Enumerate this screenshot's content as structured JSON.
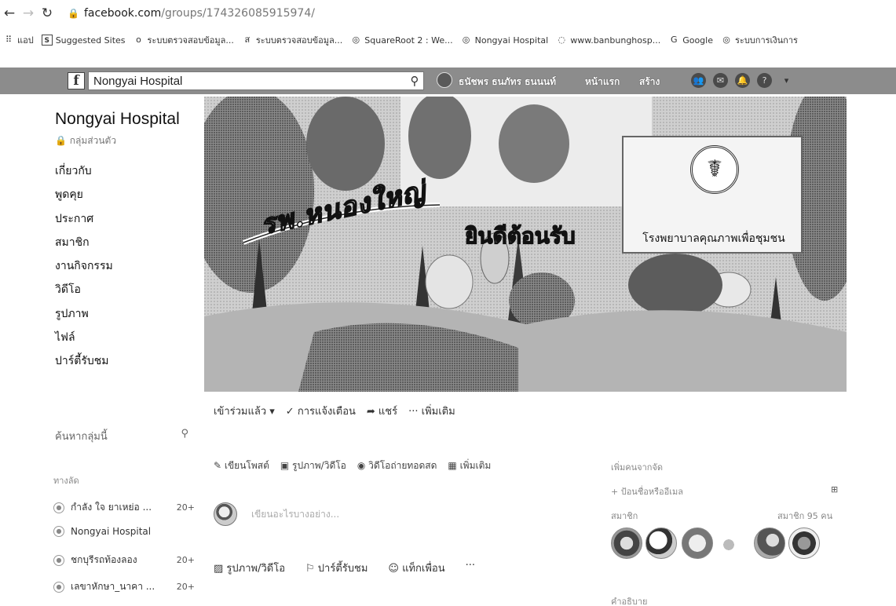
{
  "browser": {
    "url_host": "facebook.com",
    "url_path": "/groups/174326085915974/",
    "bookmarks": [
      {
        "icon": "apps-icon",
        "glyph": "⠿",
        "label": "แอป"
      },
      {
        "icon": "bookmark-icon",
        "glyph": "S",
        "label": "Suggested Sites"
      },
      {
        "icon": "site-icon",
        "glyph": "o",
        "label": "ระบบตรวจสอบข้อมูล..."
      },
      {
        "icon": "site-icon",
        "glyph": "ส",
        "label": "ระบบตรวจสอบข้อมูล..."
      },
      {
        "icon": "globe-icon",
        "glyph": "◎",
        "label": "SquareRoot 2 : We..."
      },
      {
        "icon": "globe-icon",
        "glyph": "◎",
        "label": "Nongyai Hospital"
      },
      {
        "icon": "site-icon",
        "glyph": "◌",
        "label": "www.banbunghosp..."
      },
      {
        "icon": "google-icon",
        "glyph": "G",
        "label": "Google"
      },
      {
        "icon": "globe-icon",
        "glyph": "◎",
        "label": "ระบบการเงินการ"
      }
    ]
  },
  "topbar": {
    "search_value": "Nongyai  Hospital",
    "user_name": "ธนัชพร ธนภัทร ธนนนท์",
    "home": "หน้าแรก",
    "create": "สร้าง"
  },
  "group": {
    "name": "Nongyai Hospital",
    "type": "กลุ่มส่วนตัว",
    "menu": [
      "เกี่ยวกับ",
      "พูดคุย",
      "ประกาศ",
      "สมาชิก",
      "งานกิจกรรม",
      "วิดีโอ",
      "รูปภาพ",
      "ไฟล์",
      "ปาร์ตี้รับชม"
    ],
    "search_placeholder": "ค้นหากลุ่มนี้",
    "shortcuts_title": "ทางลัด",
    "shortcuts": [
      {
        "label": "กำลัง ใจ ยาเหย่อ ...",
        "count": "20+"
      },
      {
        "label": "Nongyai Hospital",
        "count": ""
      },
      {
        "label": "ชกบุรีรถท้องลอง",
        "count": "20+"
      },
      {
        "label": "เลขาหักษา_นาคา ...",
        "count": "20+"
      }
    ]
  },
  "cover": {
    "banner_text": "รพ.หนองใหญ่",
    "welcome_text": "ยินดีต้อนรับ",
    "sign_text": "โรงพยาบาลคุณภาพเพื่อชุมชน"
  },
  "actions": [
    "เข้าร่วมแล้ว ▾",
    "✓ การแจ้งเตือน",
    "➦ แชร์",
    "··· เพิ่มเติม"
  ],
  "composer": {
    "tabs": [
      "✎ เขียนโพสต์",
      "▣ รูปภาพ/วิดีโอ",
      "◉ วิดีโอถ่ายทอดสด",
      "▦ เพิ่มเติม"
    ],
    "placeholder": "เขียนอะไรบางอย่าง...",
    "buttons": [
      "▨ รูปภาพ/วิดีโอ",
      "⚐ ปาร์ตี้รับชม",
      "☺ แท็กเพื่อน",
      "···"
    ]
  },
  "right": {
    "recent_label": "เพิ่มคนจากจัด",
    "invite_label": "+ ป้อนชื่อหรืออีเมล",
    "members_label": "สมาชิก",
    "members_count": "สมาชิก 95 คน",
    "bottom_label": "คำอธิบาย"
  }
}
